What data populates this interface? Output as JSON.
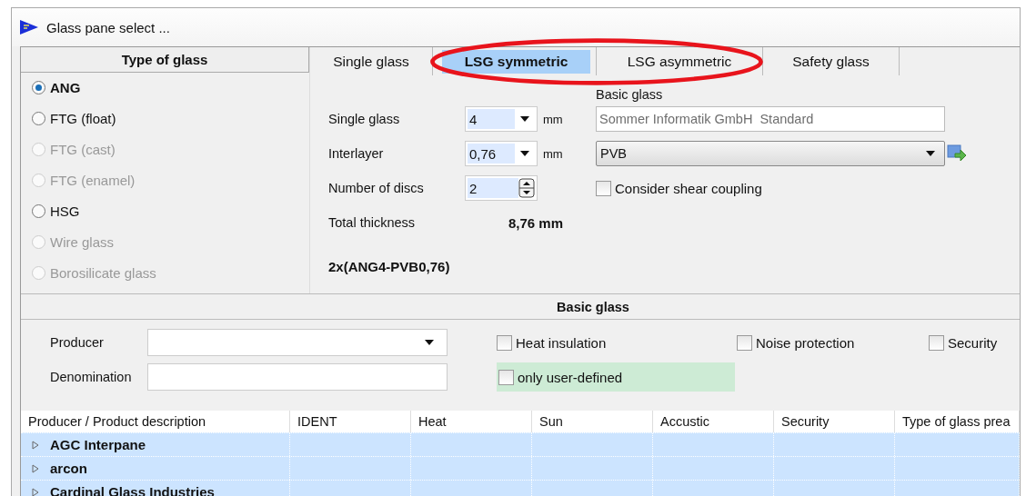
{
  "window": {
    "title": "Glass pane select ..."
  },
  "type_of_glass": {
    "header": "Type of glass",
    "options": [
      {
        "label": "ANG",
        "selected": true,
        "disabled": false
      },
      {
        "label": "FTG (float)",
        "selected": false,
        "disabled": false
      },
      {
        "label": "FTG (cast)",
        "selected": false,
        "disabled": true
      },
      {
        "label": "FTG (enamel)",
        "selected": false,
        "disabled": true
      },
      {
        "label": "HSG",
        "selected": false,
        "disabled": false
      },
      {
        "label": "Wire glass",
        "selected": false,
        "disabled": true
      },
      {
        "label": "Borosilicate glass",
        "selected": false,
        "disabled": true
      }
    ]
  },
  "tabs": [
    {
      "label": "Single glass",
      "selected": false
    },
    {
      "label": "LSG symmetric",
      "selected": true
    },
    {
      "label": "LSG asymmetric",
      "selected": false
    },
    {
      "label": "Safety glass",
      "selected": false
    }
  ],
  "form": {
    "single_glass": {
      "label": "Single glass",
      "value": "4",
      "unit": "mm"
    },
    "interlayer": {
      "label": "Interlayer",
      "value": "0,76",
      "unit": "mm"
    },
    "discs": {
      "label": "Number of discs",
      "value": "2"
    },
    "total": {
      "label": "Total thickness",
      "value": "8,76 mm"
    },
    "formula": "2x(ANG4-PVB0,76)",
    "basic_glass": {
      "label": "Basic glass",
      "value": "Sommer Informatik GmbH  Standard"
    },
    "interlayer_material": "PVB",
    "shear_coupling": {
      "label": "Consider shear coupling",
      "checked": false
    }
  },
  "basic_glass": {
    "header": "Basic glass",
    "producer_label": "Producer",
    "denomination_label": "Denomination",
    "filters": [
      {
        "label": "Heat insulation",
        "checked": false
      },
      {
        "label": "Noise protection",
        "checked": false
      },
      {
        "label": "Security",
        "checked": false
      }
    ],
    "only_user_defined": {
      "label": "only user-defined",
      "checked": false
    }
  },
  "table": {
    "columns": [
      "Producer / Product description",
      "IDENT",
      "Heat",
      "Sun",
      "Accustic",
      "Security",
      "Type of glass prea"
    ],
    "rows": [
      {
        "name": "AGC Interpane",
        "expanded": false
      },
      {
        "name": "arcon",
        "expanded": false
      },
      {
        "name": "Cardinal Glass Industries",
        "expanded": false
      }
    ]
  }
}
